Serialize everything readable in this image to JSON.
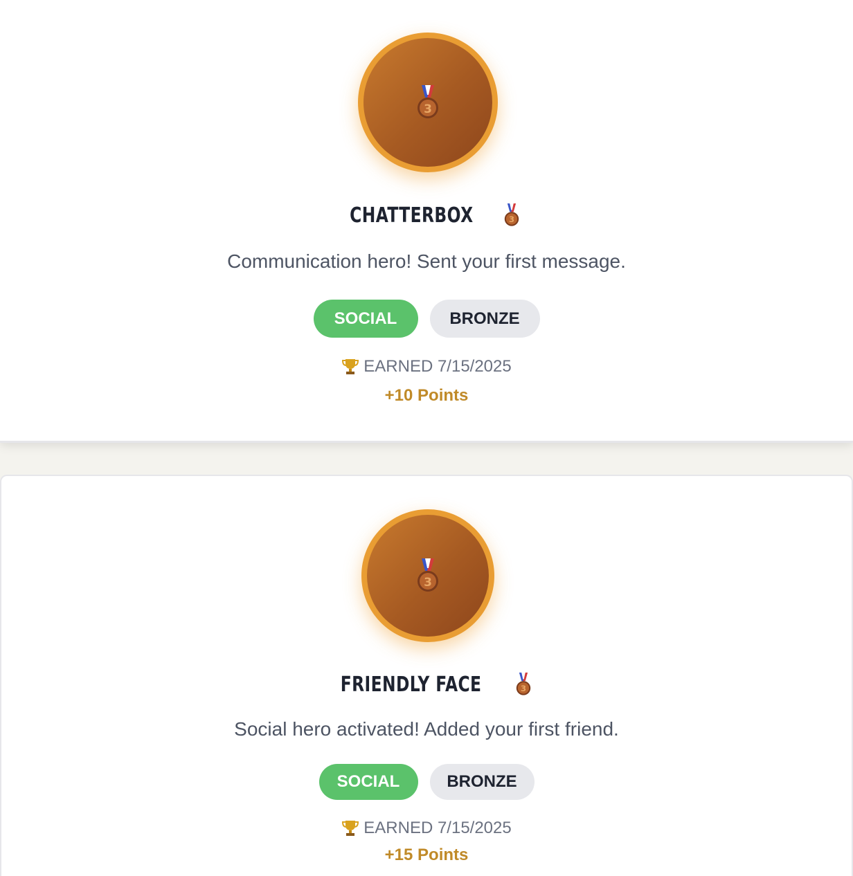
{
  "achievements": [
    {
      "title": "CHATTERBOX",
      "description": "Communication hero! Sent your first message.",
      "category": "SOCIAL",
      "tier": "BRONZE",
      "earned": "EARNED 7/15/2025",
      "points": "+10 Points",
      "icon": "bronze-medal-icon"
    },
    {
      "title": "FRIENDLY FACE",
      "description": "Social hero activated! Added your first friend.",
      "category": "SOCIAL",
      "tier": "BRONZE",
      "earned": "EARNED 7/15/2025",
      "points": "+15 Points",
      "icon": "bronze-medal-icon"
    }
  ],
  "colors": {
    "badge_ring": "#e99d33",
    "badge_fill": "#a65a22",
    "social_tag": "#5bc26b",
    "tier_tag": "#e7e8ec",
    "points": "#c08a28"
  }
}
